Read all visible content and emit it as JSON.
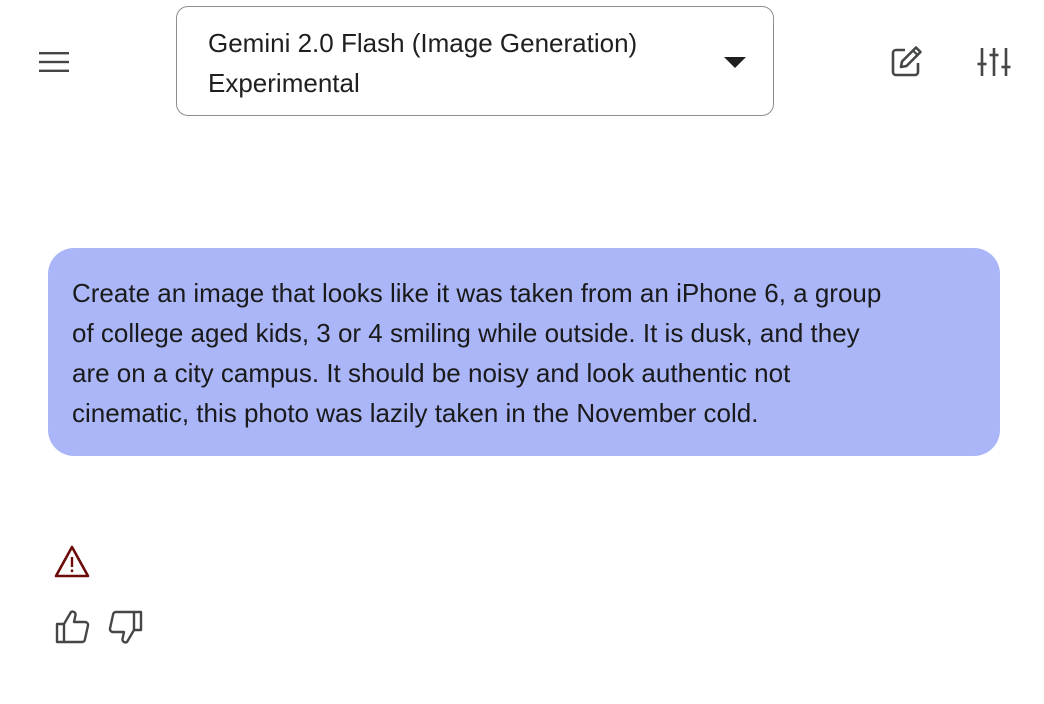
{
  "header": {
    "menu_icon": "hamburger-menu-icon",
    "model_selector": {
      "selected_value": "Gemini 2.0 Flash (Image Generation) Experimental",
      "caret_icon": "caret-down-icon"
    },
    "new_chat_icon": "edit-pencil-icon",
    "settings_icon": "tune-sliders-icon"
  },
  "conversation": {
    "user_prompt": "Create an image that looks like it was taken from an iPhone 6, a group\nof college aged kids, 3 or 4 smiling while outside. It is dusk, and they\nare on a city campus. It should be noisy and look authentic not\ncinematic, this photo was lazily taken in the November cold.",
    "response": {
      "status_icon": "warning-triangle-icon",
      "feedback": {
        "like_icon": "thumbs-up-icon",
        "dislike_icon": "thumbs-down-icon"
      }
    }
  },
  "colors": {
    "prompt_bubble": "#aab6f7",
    "warning": "#6d0b0b",
    "icon": "#444746"
  }
}
